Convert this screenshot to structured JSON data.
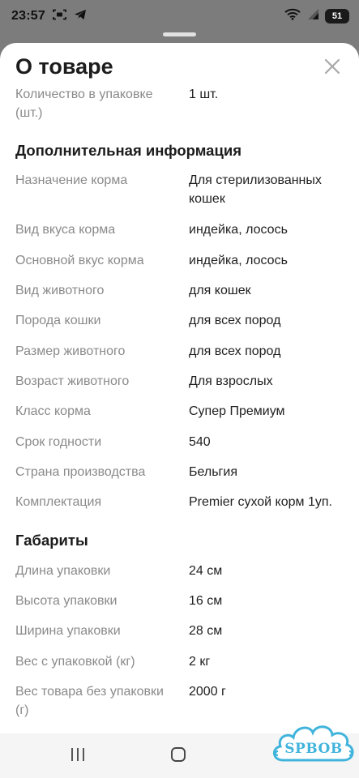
{
  "status_bar": {
    "time": "23:57",
    "battery_level": "51",
    "icons": [
      "screenshot-icon",
      "telegram-icon",
      "wifi-icon",
      "signal-icon",
      "battery-icon"
    ]
  },
  "sheet": {
    "title": "О товаре",
    "close_icon": "close-icon"
  },
  "rows_top": [
    {
      "label": "Количество в упаковке (шт.)",
      "value": "1 шт."
    }
  ],
  "sections": [
    {
      "heading": "Дополнительная информация",
      "rows": [
        {
          "label": "Назначение корма",
          "value": "Для стерилизованных кошек"
        },
        {
          "label": "Вид вкуса корма",
          "value": "индейка, лосось"
        },
        {
          "label": "Основной вкус корма",
          "value": "индейка, лосось"
        },
        {
          "label": "Вид животного",
          "value": "для кошек"
        },
        {
          "label": "Порода кошки",
          "value": "для всех пород"
        },
        {
          "label": "Размер животного",
          "value": "для всех пород"
        },
        {
          "label": "Возраст животного",
          "value": "Для взрослых"
        },
        {
          "label": "Класс корма",
          "value": "Супер Премиум"
        },
        {
          "label": "Срок годности",
          "value": "540"
        },
        {
          "label": "Страна производства",
          "value": "Бельгия"
        },
        {
          "label": "Комплектация",
          "value": "Premier сухой корм 1уп."
        }
      ]
    },
    {
      "heading": "Габариты",
      "rows": [
        {
          "label": "Длина упаковки",
          "value": "24 см"
        },
        {
          "label": "Высота упаковки",
          "value": "16 см"
        },
        {
          "label": "Ширина упаковки",
          "value": "28 см"
        },
        {
          "label": "Вес с упаковкой (кг)",
          "value": "2 кг"
        },
        {
          "label": "Вес товара без упаковки (г)",
          "value": "2000 г"
        }
      ]
    }
  ],
  "nav_bar": {
    "icons": [
      "recent-apps-icon",
      "home-icon"
    ]
  },
  "watermark": {
    "text": "SPBOB"
  },
  "colors": {
    "label": "#8a8a8a",
    "value": "#1f1f1f",
    "heading": "#1c1c1c",
    "backdrop": "#7c7c7c",
    "sheet": "#ffffff",
    "watermark": "#41b4dc"
  }
}
